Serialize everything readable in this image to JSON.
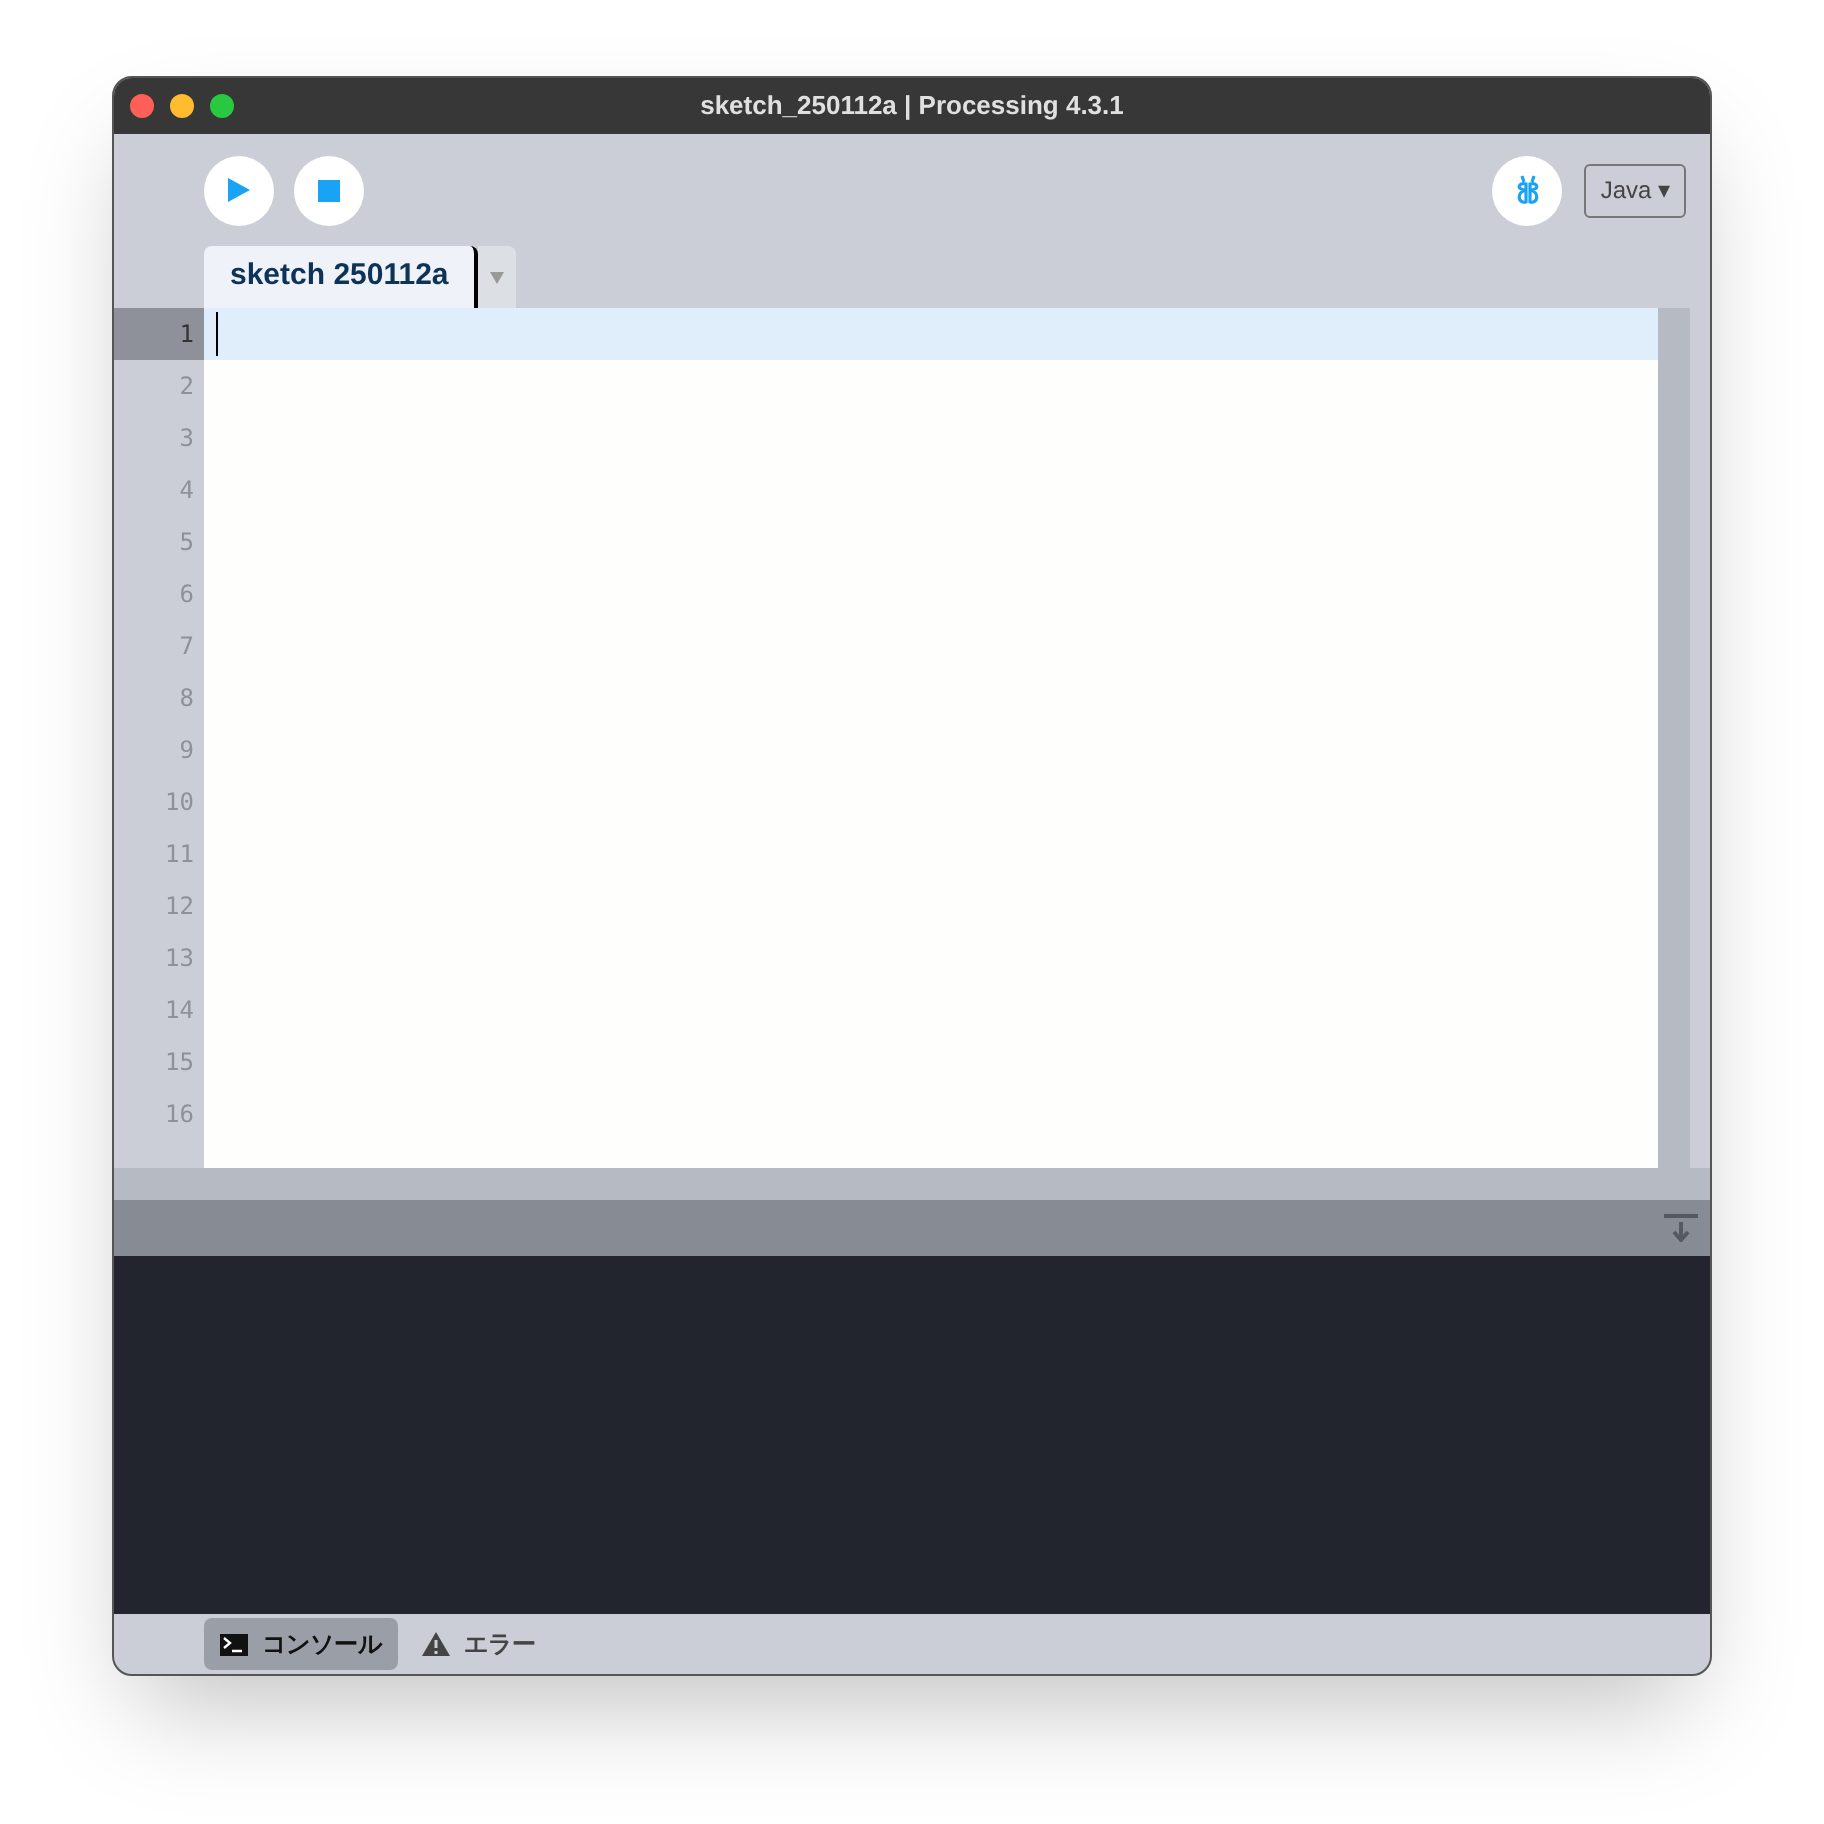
{
  "window": {
    "title": "sketch_250112a | Processing 4.3.1"
  },
  "mode": {
    "label": "Java ▾"
  },
  "editor_tabs": [
    {
      "label": "sketch 250112a",
      "selected": true
    }
  ],
  "lines": [
    {
      "number": "1",
      "selected": true
    },
    {
      "number": "2",
      "selected": false
    },
    {
      "number": "3",
      "selected": false
    },
    {
      "number": "4",
      "selected": false
    },
    {
      "number": "5",
      "selected": false
    },
    {
      "number": "6",
      "selected": false
    },
    {
      "number": "7",
      "selected": false
    },
    {
      "number": "8",
      "selected": false
    },
    {
      "number": "9",
      "selected": false
    },
    {
      "number": "10",
      "selected": false
    },
    {
      "number": "11",
      "selected": false
    },
    {
      "number": "12",
      "selected": false
    },
    {
      "number": "13",
      "selected": false
    },
    {
      "number": "14",
      "selected": false
    },
    {
      "number": "15",
      "selected": false
    },
    {
      "number": "16",
      "selected": false
    }
  ],
  "bottom_tabs": [
    {
      "label": "コンソール",
      "kind": "console",
      "selected": true
    },
    {
      "label": "エラー",
      "kind": "error",
      "selected": false
    }
  ]
}
